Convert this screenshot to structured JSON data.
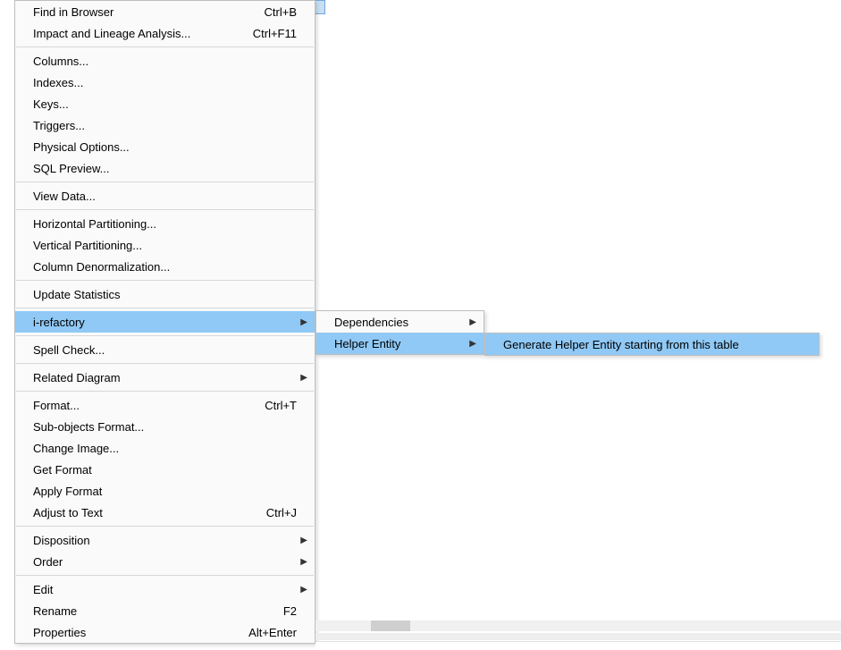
{
  "main_menu": {
    "groups": [
      [
        {
          "label": "Find in Browser",
          "shortcut": "Ctrl+B"
        },
        {
          "label": "Impact and Lineage Analysis...",
          "shortcut": "Ctrl+F11"
        }
      ],
      [
        {
          "label": "Columns..."
        },
        {
          "label": "Indexes..."
        },
        {
          "label": "Keys..."
        },
        {
          "label": "Triggers..."
        },
        {
          "label": "Physical Options..."
        },
        {
          "label": "SQL Preview..."
        }
      ],
      [
        {
          "label": "View Data..."
        }
      ],
      [
        {
          "label": "Horizontal Partitioning..."
        },
        {
          "label": "Vertical Partitioning..."
        },
        {
          "label": "Column Denormalization..."
        }
      ],
      [
        {
          "label": "Update Statistics"
        }
      ],
      [
        {
          "label": "i-refactory",
          "submenu": true,
          "highlight": true
        }
      ],
      [
        {
          "label": "Spell Check..."
        }
      ],
      [
        {
          "label": "Related Diagram",
          "submenu": true
        }
      ],
      [
        {
          "label": "Format...",
          "shortcut": "Ctrl+T"
        },
        {
          "label": "Sub-objects Format..."
        },
        {
          "label": "Change Image..."
        },
        {
          "label": "Get Format"
        },
        {
          "label": "Apply Format"
        },
        {
          "label": "Adjust to Text",
          "shortcut": "Ctrl+J"
        }
      ],
      [
        {
          "label": "Disposition",
          "submenu": true
        },
        {
          "label": "Order",
          "submenu": true
        }
      ],
      [
        {
          "label": "Edit",
          "submenu": true
        },
        {
          "label": "Rename",
          "shortcut": "F2"
        },
        {
          "label": "Properties",
          "shortcut": "Alt+Enter"
        }
      ]
    ]
  },
  "submenu1": {
    "items": [
      {
        "label": "Dependencies",
        "submenu": true
      },
      {
        "label": "Helper Entity",
        "submenu": true,
        "highlight": true
      }
    ]
  },
  "submenu2": {
    "items": [
      {
        "label": "Generate Helper Entity starting from this table",
        "highlight": true
      }
    ]
  }
}
